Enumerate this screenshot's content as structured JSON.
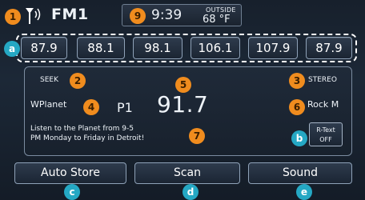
{
  "colors": {
    "orange_marker": "#f08c1e",
    "teal_marker": "#25a8c4",
    "screen_background": "#17202c",
    "button_border": "#8fa2b8"
  },
  "status_bar": {
    "antenna_icon": "antenna-signal-icon",
    "band": "FM1",
    "clock": "9:39",
    "outside_label": "OUTSIDE",
    "outside_temp": "68 °F"
  },
  "presets": [
    "87.9",
    "88.1",
    "98.1",
    "106.1",
    "107.9",
    "87.9"
  ],
  "info": {
    "seek_label": "SEEK",
    "stereo_label": "STEREO",
    "station_name": "WPlanet",
    "preset_number": "P1",
    "frequency": "91.7",
    "genre": "Rock M",
    "radio_text_line1": "Listen to the Planet from 9-5",
    "radio_text_line2": "PM Monday to Friday in Detroit!",
    "rtext_button_line1": "R-Text",
    "rtext_button_line2": "OFF"
  },
  "bottom_buttons": {
    "auto_store": "Auto Store",
    "scan": "Scan",
    "sound": "Sound"
  },
  "markers": {
    "m1": "1",
    "m2": "2",
    "m3": "3",
    "m4": "4",
    "m5": "5",
    "m6": "6",
    "m7": "7",
    "m9": "9",
    "ma": "a",
    "mb": "b",
    "mc": "c",
    "md": "d",
    "me": "e"
  }
}
